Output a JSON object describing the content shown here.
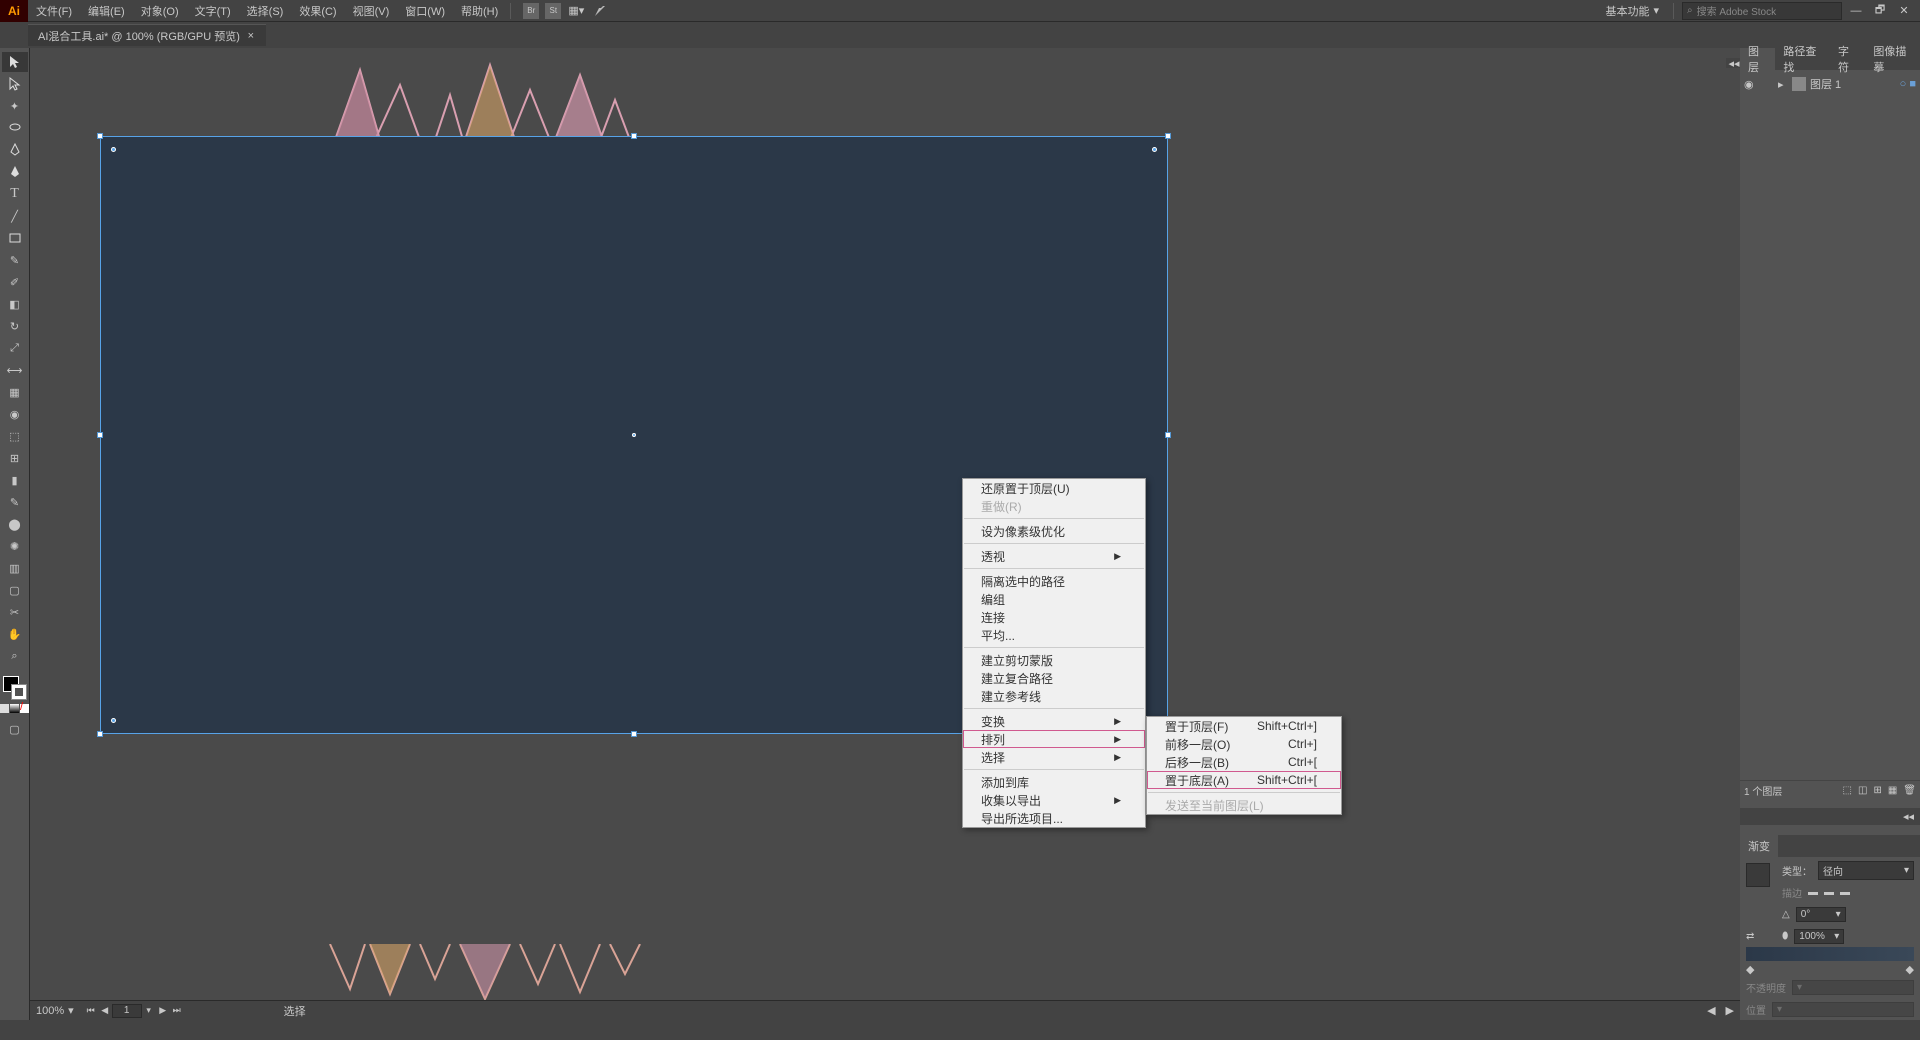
{
  "menu": {
    "file": "文件(F)",
    "edit": "编辑(E)",
    "object": "对象(O)",
    "type": "文字(T)",
    "select": "选择(S)",
    "effect": "效果(C)",
    "view": "视图(V)",
    "window": "窗口(W)",
    "help": "帮助(H)"
  },
  "topRight": {
    "workspace": "基本功能",
    "searchPlaceholder": "搜索 Adobe Stock"
  },
  "tab": {
    "title": "AI混合工具.ai* @ 100% (RGB/GPU 预览)"
  },
  "contextMenu1": {
    "undoBringToFront": "还原置于顶层(U)",
    "redo": "重做(R)",
    "pixelOptimize": "设为像素级优化",
    "perspective": "透视",
    "isolate": "隔离选中的路径",
    "ungroup": "编组",
    "join": "连接",
    "average": "平均...",
    "clippingMask": "建立剪切蒙版",
    "compoundPath": "建立复合路径",
    "guides": "建立参考线",
    "transform": "变换",
    "arrange": "排列",
    "selectMenu": "选择",
    "addToLibrary": "添加到库",
    "exportCollect": "收集以导出",
    "exportSelected": "导出所选项目..."
  },
  "contextMenu2": {
    "bringToFront": "置于顶层(F)",
    "bringToFrontKey": "Shift+Ctrl+]",
    "bringForward": "前移一层(O)",
    "bringForwardKey": "Ctrl+]",
    "sendBackward": "后移一层(B)",
    "sendBackwardKey": "Ctrl+[",
    "sendToBack": "置于底层(A)",
    "sendToBackKey": "Shift+Ctrl+[",
    "sendToCurrent": "发送至当前图层(L)"
  },
  "panels": {
    "layersTab": "图层",
    "pathfinderTab": "路径查找",
    "charTab": "字符",
    "imageTraceTab": "图像描摹",
    "layerName": "图层 1",
    "layerCount": "1 个图层",
    "gradientTab": "渐变",
    "typeLabel": "类型：",
    "typeValue": "径向",
    "styleLabel": "描边",
    "angle": "0°",
    "opacity": "100%",
    "opacityLabel": "不透明度",
    "positionLabel": "位置"
  },
  "status": {
    "zoom": "100%",
    "page": "1",
    "tool": "选择"
  }
}
